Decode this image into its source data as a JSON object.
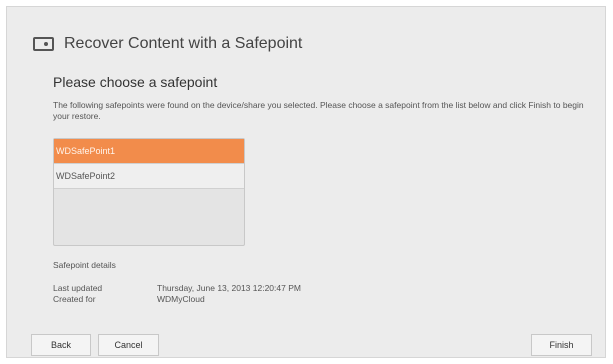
{
  "dialog": {
    "title": "Recover Content with a Safepoint",
    "heading": "Please choose a safepoint",
    "description": "The following safepoints were found on the device/share you selected. Please choose a safepoint from the list below and click Finish to begin your restore.",
    "safepoints": [
      {
        "label": "WDSafePoint1",
        "selected": true
      },
      {
        "label": "WDSafePoint2",
        "selected": false
      }
    ],
    "details_label": "Safepoint details",
    "details": {
      "last_updated_key": "Last updated",
      "last_updated_value": "Thursday, June 13, 2013 12:20:47 PM",
      "created_for_key": "Created for",
      "created_for_value": "WDMyCloud"
    },
    "buttons": {
      "back": "Back",
      "cancel": "Cancel",
      "finish": "Finish"
    }
  },
  "icons": {
    "title_icon": "drive-icon"
  },
  "colors": {
    "selected_item": "#f28c4b",
    "background": "#ececec"
  }
}
